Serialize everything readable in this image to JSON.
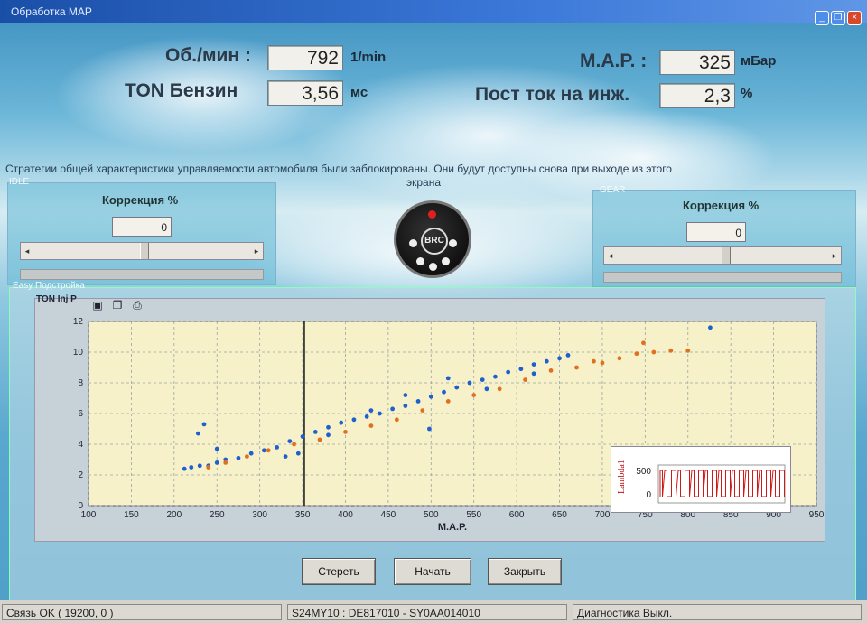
{
  "window": {
    "title": "Обработка MAP"
  },
  "readouts": {
    "rpm": {
      "label": "Об./мин :",
      "value": "792",
      "unit": "1/min"
    },
    "ton": {
      "label": "TON Бензин",
      "value": "3,56",
      "unit": "мс"
    },
    "map": {
      "label": "M.A.P. :",
      "value": "325",
      "unit": "мБар"
    },
    "inj": {
      "label": "Пост ток на инж.",
      "value": "2,3",
      "unit": "%"
    }
  },
  "message": "Стратегии общей характеристики управляемости автомобиля были заблокированы. Они будут доступны снова при выходе из этого",
  "message_tail": "экрана",
  "left_panel": {
    "title": "IDLE",
    "corr_label": "Коррекция %",
    "corr_value": "0"
  },
  "right_panel": {
    "title": "GEAR",
    "corr_label": "Коррекция %",
    "corr_value": "0"
  },
  "logo": {
    "text": "BRC"
  },
  "easy": {
    "title": "Easy Подстройка",
    "chart_label": "TON Inj P"
  },
  "chart_data": {
    "type": "scatter",
    "xlabel": "M.A.P.",
    "ylabel": "",
    "xlim": [
      100,
      950
    ],
    "ylim": [
      0,
      12
    ],
    "x_ticks": [
      100,
      150,
      200,
      250,
      300,
      350,
      400,
      450,
      500,
      550,
      600,
      650,
      700,
      750,
      800,
      850,
      900,
      950
    ],
    "y_ticks": [
      0,
      2,
      4,
      6,
      8,
      10,
      12
    ],
    "marker_x": 352,
    "grid": true,
    "series": [
      {
        "color": "#1f5fcf",
        "points": [
          [
            212,
            2.4
          ],
          [
            220,
            2.5
          ],
          [
            230,
            2.6
          ],
          [
            240,
            2.6
          ],
          [
            250,
            2.8
          ],
          [
            260,
            3.0
          ],
          [
            275,
            3.1
          ],
          [
            290,
            3.4
          ],
          [
            305,
            3.6
          ],
          [
            320,
            3.8
          ],
          [
            335,
            4.2
          ],
          [
            350,
            4.5
          ],
          [
            365,
            4.8
          ],
          [
            380,
            5.1
          ],
          [
            395,
            5.4
          ],
          [
            410,
            5.6
          ],
          [
            425,
            5.8
          ],
          [
            440,
            6.0
          ],
          [
            455,
            6.3
          ],
          [
            470,
            6.5
          ],
          [
            485,
            6.8
          ],
          [
            500,
            7.1
          ],
          [
            515,
            7.4
          ],
          [
            530,
            7.7
          ],
          [
            545,
            8.0
          ],
          [
            560,
            8.2
          ],
          [
            575,
            8.4
          ],
          [
            590,
            8.7
          ],
          [
            605,
            8.9
          ],
          [
            620,
            9.2
          ],
          [
            635,
            9.4
          ],
          [
            650,
            9.6
          ],
          [
            660,
            9.8
          ],
          [
            235,
            5.3
          ],
          [
            228,
            4.7
          ],
          [
            250,
            3.7
          ],
          [
            330,
            3.2
          ],
          [
            345,
            3.4
          ],
          [
            380,
            4.6
          ],
          [
            430,
            6.2
          ],
          [
            470,
            7.2
          ],
          [
            520,
            8.3
          ],
          [
            565,
            7.6
          ],
          [
            620,
            8.6
          ],
          [
            498,
            5.0
          ],
          [
            826,
            11.6
          ]
        ]
      },
      {
        "color": "#e07020",
        "points": [
          [
            240,
            2.5
          ],
          [
            260,
            2.8
          ],
          [
            285,
            3.2
          ],
          [
            310,
            3.6
          ],
          [
            340,
            4.0
          ],
          [
            370,
            4.3
          ],
          [
            400,
            4.8
          ],
          [
            430,
            5.2
          ],
          [
            460,
            5.6
          ],
          [
            490,
            6.2
          ],
          [
            520,
            6.8
          ],
          [
            550,
            7.2
          ],
          [
            580,
            7.6
          ],
          [
            610,
            8.2
          ],
          [
            640,
            8.8
          ],
          [
            670,
            9.0
          ],
          [
            700,
            9.3
          ],
          [
            720,
            9.6
          ],
          [
            740,
            9.9
          ],
          [
            760,
            10.0
          ],
          [
            780,
            10.1
          ],
          [
            800,
            10.1
          ],
          [
            748,
            10.6
          ],
          [
            690,
            9.4
          ]
        ]
      }
    ],
    "inset": {
      "ylabel": "Lambda1",
      "ticks": [
        "500",
        "0"
      ]
    }
  },
  "buttons": {
    "erase": "Стереть",
    "start": "Начать",
    "close": "Закрыть"
  },
  "status": {
    "conn": "Связь OK ( 19200,  0 )",
    "ident": "S24MY10 : DE817010 - SY0AA014010",
    "diag": "Диагностика Выкл."
  }
}
